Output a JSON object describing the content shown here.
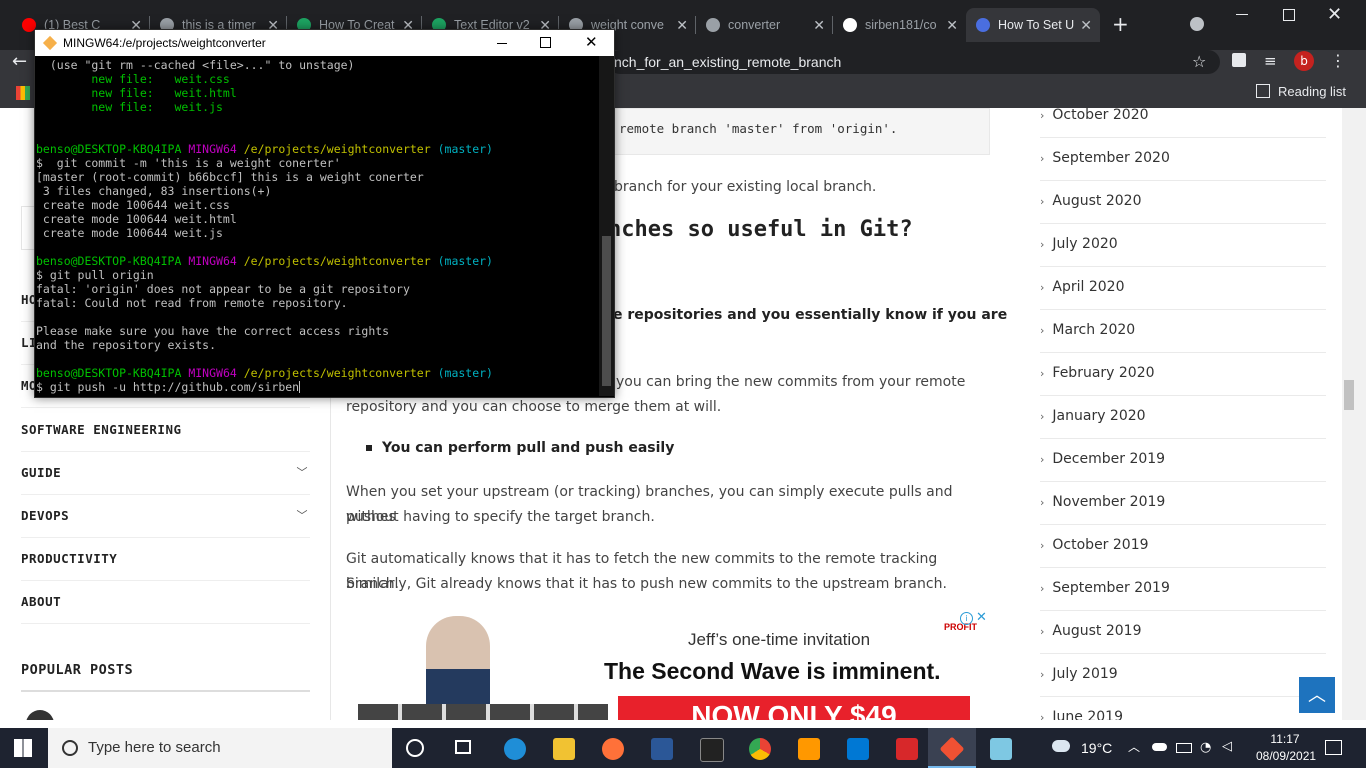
{
  "browser": {
    "tabs": [
      {
        "label": "(1) Best C",
        "color": "#ff0000"
      },
      {
        "label": "this is a timer",
        "color": "#9aa0a6"
      },
      {
        "label": "How To Creat",
        "color": "#1da462"
      },
      {
        "label": "Text Editor v2",
        "color": "#1da462"
      },
      {
        "label": "weight conve",
        "color": "#9aa0a6"
      },
      {
        "label": "converter",
        "color": "#9aa0a6"
      },
      {
        "label": "sirben181/co",
        "color": "#ffffff"
      },
      {
        "label": "How To Set U",
        "color": "#4a6ee0"
      }
    ],
    "new_tab": "+",
    "url": "nch_for_an_existing_remote_branch",
    "profile_initial": "b",
    "reading_list": "Reading list"
  },
  "terminal": {
    "title": "MINGW64:/e/projects/weightconverter",
    "lines": [
      [
        {
          "t": "  (use \"git rm --cached <file>...\" to unstage)",
          "c": ""
        }
      ],
      [
        {
          "t": "        new file:   weit.css",
          "c": "g"
        }
      ],
      [
        {
          "t": "        new file:   weit.html",
          "c": "g"
        }
      ],
      [
        {
          "t": "        new file:   weit.js",
          "c": "g"
        }
      ],
      [
        {
          "t": "",
          "c": ""
        }
      ],
      [
        {
          "t": "",
          "c": ""
        }
      ],
      [
        {
          "t": "benso@DESKTOP-KBQ4IPA ",
          "c": "g"
        },
        {
          "t": "MINGW64 ",
          "c": "m"
        },
        {
          "t": "/e/projects/weightconverter ",
          "c": "y"
        },
        {
          "t": "(master)",
          "c": "c"
        }
      ],
      [
        {
          "t": "$  git commit -m 'this is a weight conerter'",
          "c": ""
        }
      ],
      [
        {
          "t": "[master (root-commit) b66bccf] this is a weight conerter",
          "c": ""
        }
      ],
      [
        {
          "t": " 3 files changed, 83 insertions(+)",
          "c": ""
        }
      ],
      [
        {
          "t": " create mode 100644 weit.css",
          "c": ""
        }
      ],
      [
        {
          "t": " create mode 100644 weit.html",
          "c": ""
        }
      ],
      [
        {
          "t": " create mode 100644 weit.js",
          "c": ""
        }
      ],
      [
        {
          "t": "",
          "c": ""
        }
      ],
      [
        {
          "t": "benso@DESKTOP-KBQ4IPA ",
          "c": "g"
        },
        {
          "t": "MINGW64 ",
          "c": "m"
        },
        {
          "t": "/e/projects/weightconverter ",
          "c": "y"
        },
        {
          "t": "(master)",
          "c": "c"
        }
      ],
      [
        {
          "t": "$ git pull origin",
          "c": ""
        }
      ],
      [
        {
          "t": "fatal: 'origin' does not appear to be a git repository",
          "c": ""
        }
      ],
      [
        {
          "t": "fatal: Could not read from remote repository.",
          "c": ""
        }
      ],
      [
        {
          "t": "",
          "c": ""
        }
      ],
      [
        {
          "t": "Please make sure you have the correct access rights",
          "c": ""
        }
      ],
      [
        {
          "t": "and the repository exists.",
          "c": ""
        }
      ],
      [
        {
          "t": "",
          "c": ""
        }
      ],
      [
        {
          "t": "benso@DESKTOP-KBQ4IPA ",
          "c": "g"
        },
        {
          "t": "MINGW64 ",
          "c": "m"
        },
        {
          "t": "/e/projects/weightconverter ",
          "c": "y"
        },
        {
          "t": "(master)",
          "c": "c"
        }
      ],
      [
        {
          "t": "$ git push -u http://github.com/sirben",
          "c": ""
        }
      ]
    ]
  },
  "left_nav": {
    "items": [
      {
        "label": "SOFTWARE ENGINEERING",
        "has_chevron": false
      },
      {
        "label": "GUIDE",
        "has_chevron": true
      },
      {
        "label": "DEVOPS",
        "has_chevron": true
      },
      {
        "label": "PRODUCTIVITY",
        "has_chevron": false
      },
      {
        "label": "ABOUT",
        "has_chevron": false
      }
    ],
    "partial_labels": [
      "HO",
      "LI",
      "MO"
    ],
    "popular_posts": "POPULAR POSTS"
  },
  "article": {
    "code_line": "remote branch 'master' from 'origin'.",
    "para1": "branch for your existing local branch.",
    "heading": "nches so useful in Git?",
    "bold_line": "e repositories and you essentially know if you are",
    "para2a": "you can bring the new commits from your remote",
    "para2b": "repository and you can choose to merge them at will.",
    "bullet": "You can perform pull and push easily",
    "para3a": "When you set your upstream (or tracking) branches, you can simply execute pulls and pushes",
    "para3b": "without having to specify the target branch.",
    "para4a": "Git automatically knows that it has to fetch the new commits to the remote tracking branch.",
    "para4b": "Similarly, Git already knows that it has to push new commits to the upstream branch.",
    "ad": {
      "invite": "Jeff’s one-time invitation",
      "headline": "The Second Wave is imminent.",
      "price": "NOW ONLY $49",
      "brand": "PROFIT"
    }
  },
  "archives": [
    "October 2020",
    "September 2020",
    "August 2020",
    "July 2020",
    "April 2020",
    "March 2020",
    "February 2020",
    "January 2020",
    "December 2019",
    "November 2019",
    "October 2019",
    "September 2019",
    "August 2019",
    "July 2019",
    "June 2019"
  ],
  "taskbar": {
    "search_placeholder": "Type here to search",
    "weather": "19°C",
    "time": "11:17",
    "date": "08/09/2021"
  }
}
